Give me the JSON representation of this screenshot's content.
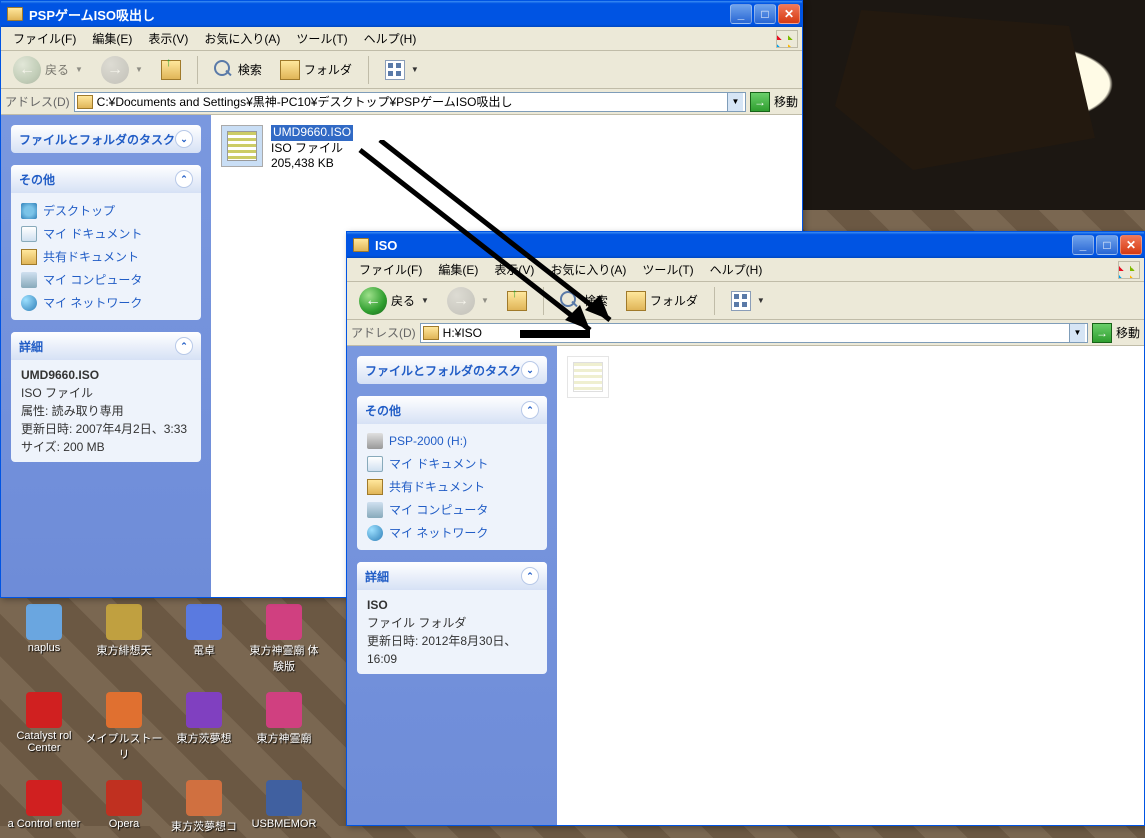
{
  "window1": {
    "title": "PSPゲームISO吸出し",
    "menu": {
      "file": "ファイル(F)",
      "edit": "編集(E)",
      "view": "表示(V)",
      "fav": "お気に入り(A)",
      "tools": "ツール(T)",
      "help": "ヘルプ(H)"
    },
    "toolbar": {
      "back": "戻る",
      "search": "検索",
      "folders": "フォルダ"
    },
    "address": {
      "label": "アドレス(D)",
      "path": "C:¥Documents and Settings¥黒神-PC10¥デスクトップ¥PSPゲームISO吸出し",
      "go": "移動"
    },
    "sidebar": {
      "tasks_hd": "ファイルとフォルダのタスク",
      "other_hd": "その他",
      "other_links": {
        "desktop": "デスクトップ",
        "mydoc": "マイ ドキュメント",
        "shared": "共有ドキュメント",
        "mycomp": "マイ コンピュータ",
        "mynet": "マイ ネットワーク"
      },
      "details_hd": "詳細",
      "details": {
        "name": "UMD9660.ISO",
        "type": "ISO ファイル",
        "attr": "属性: 読み取り専用",
        "mod": "更新日時: 2007年4月2日、3:33",
        "size": "サイズ: 200 MB"
      }
    },
    "file": {
      "name": "UMD9660.ISO",
      "type": "ISO ファイル",
      "size": "205,438 KB"
    }
  },
  "window2": {
    "title": "ISO",
    "menu": {
      "file": "ファイル(F)",
      "edit": "編集(E)",
      "view": "表示(V)",
      "fav": "お気に入り(A)",
      "tools": "ツール(T)",
      "help": "ヘルプ(H)"
    },
    "toolbar": {
      "back": "戻る",
      "search": "検索",
      "folders": "フォルダ"
    },
    "address": {
      "label": "アドレス(D)",
      "path": "H:¥ISO",
      "go": "移動"
    },
    "sidebar": {
      "tasks_hd": "ファイルとフォルダのタスク",
      "other_hd": "その他",
      "other_links": {
        "drive": "PSP-2000 (H:)",
        "mydoc": "マイ ドキュメント",
        "shared": "共有ドキュメント",
        "mycomp": "マイ コンピュータ",
        "mynet": "マイ ネットワーク"
      },
      "details_hd": "詳細",
      "details": {
        "name": "ISO",
        "type": "ファイル フォルダ",
        "mod": "更新日時: 2012年8月30日、16:09"
      }
    }
  },
  "desktop_icons": [
    {
      "label": "naplus",
      "color": "#6aa6e0"
    },
    {
      "label": "東方緋想天",
      "color": "#c0a040"
    },
    {
      "label": "電卓",
      "color": "#5a7ae0"
    },
    {
      "label": "東方神霊廟 体験版",
      "color": "#d04080"
    },
    {
      "label": "Catalyst rol Center",
      "color": "#d02020"
    },
    {
      "label": "メイプルストーリ",
      "color": "#e07030"
    },
    {
      "label": "東方茨夢想",
      "color": "#8040c0"
    },
    {
      "label": "東方神霊廟",
      "color": "#d04080"
    },
    {
      "label": "a Control enter",
      "color": "#d02020"
    },
    {
      "label": "Opera",
      "color": "#c03020"
    },
    {
      "label": "東方茨夢想コ",
      "color": "#d07040"
    },
    {
      "label": "USBMEMOR",
      "color": "#4060a0"
    }
  ]
}
